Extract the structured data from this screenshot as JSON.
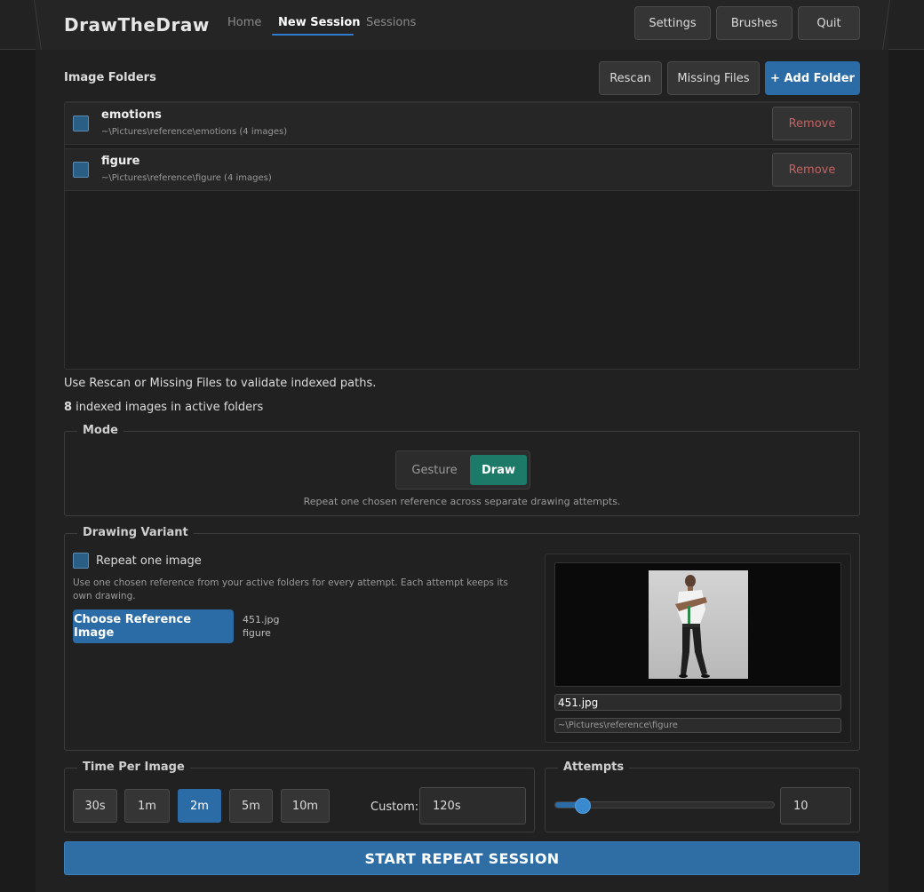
{
  "app": {
    "title": "DrawTheDraw"
  },
  "nav": {
    "home": "Home",
    "new_session": "New Session",
    "sessions": "Sessions"
  },
  "header_buttons": {
    "settings": "Settings",
    "brushes": "Brushes",
    "quit": "Quit"
  },
  "folders": {
    "title": "Image Folders",
    "rescan": "Rescan",
    "missing_files": "Missing Files",
    "add_folder": "+ Add Folder",
    "items": [
      {
        "name": "emotions",
        "path": "~\\Pictures\\reference\\emotions  (4 images)",
        "remove": "Remove",
        "checked": false
      },
      {
        "name": "figure",
        "path": "~\\Pictures\\reference\\figure  (4 images)",
        "remove": "Remove",
        "checked": false
      }
    ],
    "hint": "Use Rescan or Missing Files to validate indexed paths.",
    "indexed_count": "8",
    "indexed_label": " indexed images in active folders"
  },
  "mode": {
    "title": "Mode",
    "gesture": "Gesture",
    "draw": "Draw",
    "selected": "Draw",
    "description": "Repeat one chosen reference across separate drawing attempts."
  },
  "variant": {
    "title": "Drawing Variant",
    "repeat_label": "Repeat one image",
    "repeat_checked": false,
    "description": "Use one chosen reference from your active folders for every attempt. Each attempt keeps its own drawing.",
    "choose_button": "Choose Reference Image",
    "selected_file": "451.jpg",
    "selected_folder": "figure",
    "preview_filename": "451.jpg",
    "preview_path": "~\\Pictures\\reference\\figure"
  },
  "time": {
    "title": "Time Per Image",
    "options": [
      "30s",
      "1m",
      "2m",
      "5m",
      "10m"
    ],
    "selected": "2m",
    "custom_label": "Custom:",
    "custom_value": "120s"
  },
  "attempts": {
    "title": "Attempts",
    "value": "10",
    "slider_fraction": 0.13
  },
  "start_button": "START REPEAT SESSION",
  "colors": {
    "accent": "#2b6ba6",
    "draw_selected": "#1e7a68",
    "remove_text": "#c46262"
  }
}
